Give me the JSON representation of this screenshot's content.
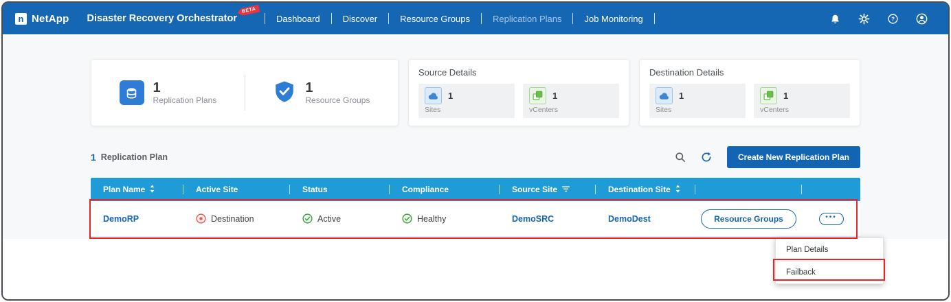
{
  "topbar": {
    "brand": "NetApp",
    "title": "Disaster Recovery Orchestrator",
    "beta_badge": "BETA",
    "nav": [
      {
        "label": "Dashboard"
      },
      {
        "label": "Discover"
      },
      {
        "label": "Resource Groups"
      },
      {
        "label": "Replication Plans"
      },
      {
        "label": "Job Monitoring"
      }
    ]
  },
  "summary": {
    "replication_plans": {
      "count": "1",
      "label": "Replication Plans"
    },
    "resource_groups": {
      "count": "1",
      "label": "Resource Groups"
    }
  },
  "source_details": {
    "title": "Source Details",
    "sites": {
      "count": "1",
      "label": "Sites"
    },
    "vcenters": {
      "count": "1",
      "label": "vCenters"
    }
  },
  "destination_details": {
    "title": "Destination Details",
    "sites": {
      "count": "1",
      "label": "Sites"
    },
    "vcenters": {
      "count": "1",
      "label": "vCenters"
    }
  },
  "plans_section": {
    "count": "1",
    "label": "Replication Plan",
    "create_button_label": "Create New Replication Plan"
  },
  "table": {
    "columns": [
      "Plan Name",
      "Active Site",
      "Status",
      "Compliance",
      "Source Site",
      "Destination Site"
    ],
    "rows": [
      {
        "plan_name": "DemoRP",
        "active_site": "Destination",
        "status": "Active",
        "compliance": "Healthy",
        "source_site": "DemoSRC",
        "destination_site": "DemoDest",
        "resource_groups_label": "Resource Groups"
      }
    ]
  },
  "context_menu": {
    "items": [
      {
        "label": "Plan Details"
      },
      {
        "label": "Failback"
      }
    ]
  },
  "colors": {
    "topbar_blue": "#1567b3",
    "table_header_blue": "#1f9cd7",
    "primary_blue": "#1464b4",
    "success_green": "#3da144",
    "destination_red": "#e06060",
    "annotation_red": "#e8242b",
    "beta_red": "#e8353f"
  }
}
